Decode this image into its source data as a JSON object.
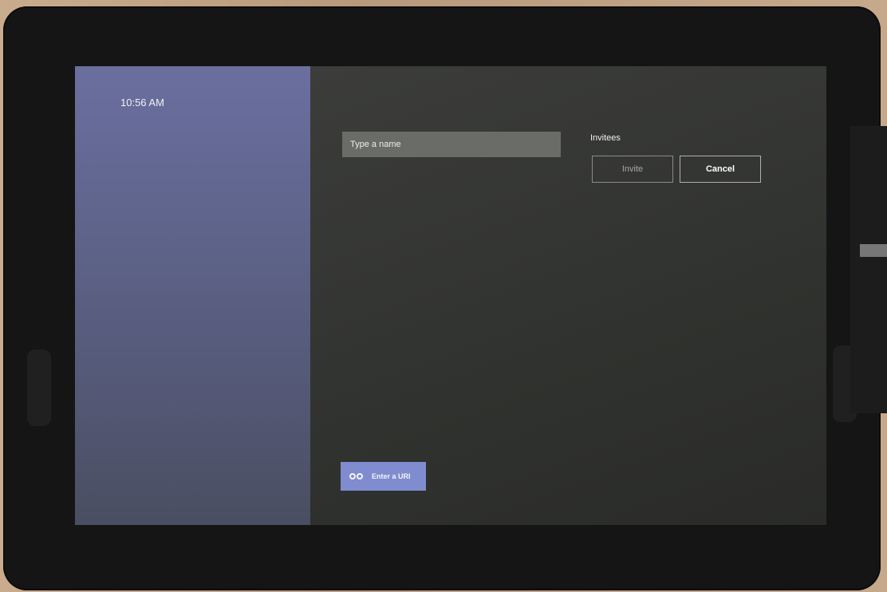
{
  "status": {
    "time": "10:56 AM"
  },
  "invite_form": {
    "name_placeholder": "Type a name",
    "invitees_label": "Invitees",
    "invite_label": "Invite",
    "cancel_label": "Cancel"
  },
  "footer": {
    "enter_uri_label": "Enter a URI",
    "enter_uri_icon": "link-icon"
  },
  "colors": {
    "left_pane": "#5c6186",
    "accent_button": "#7f8ccf",
    "content_background": "#30322f"
  }
}
